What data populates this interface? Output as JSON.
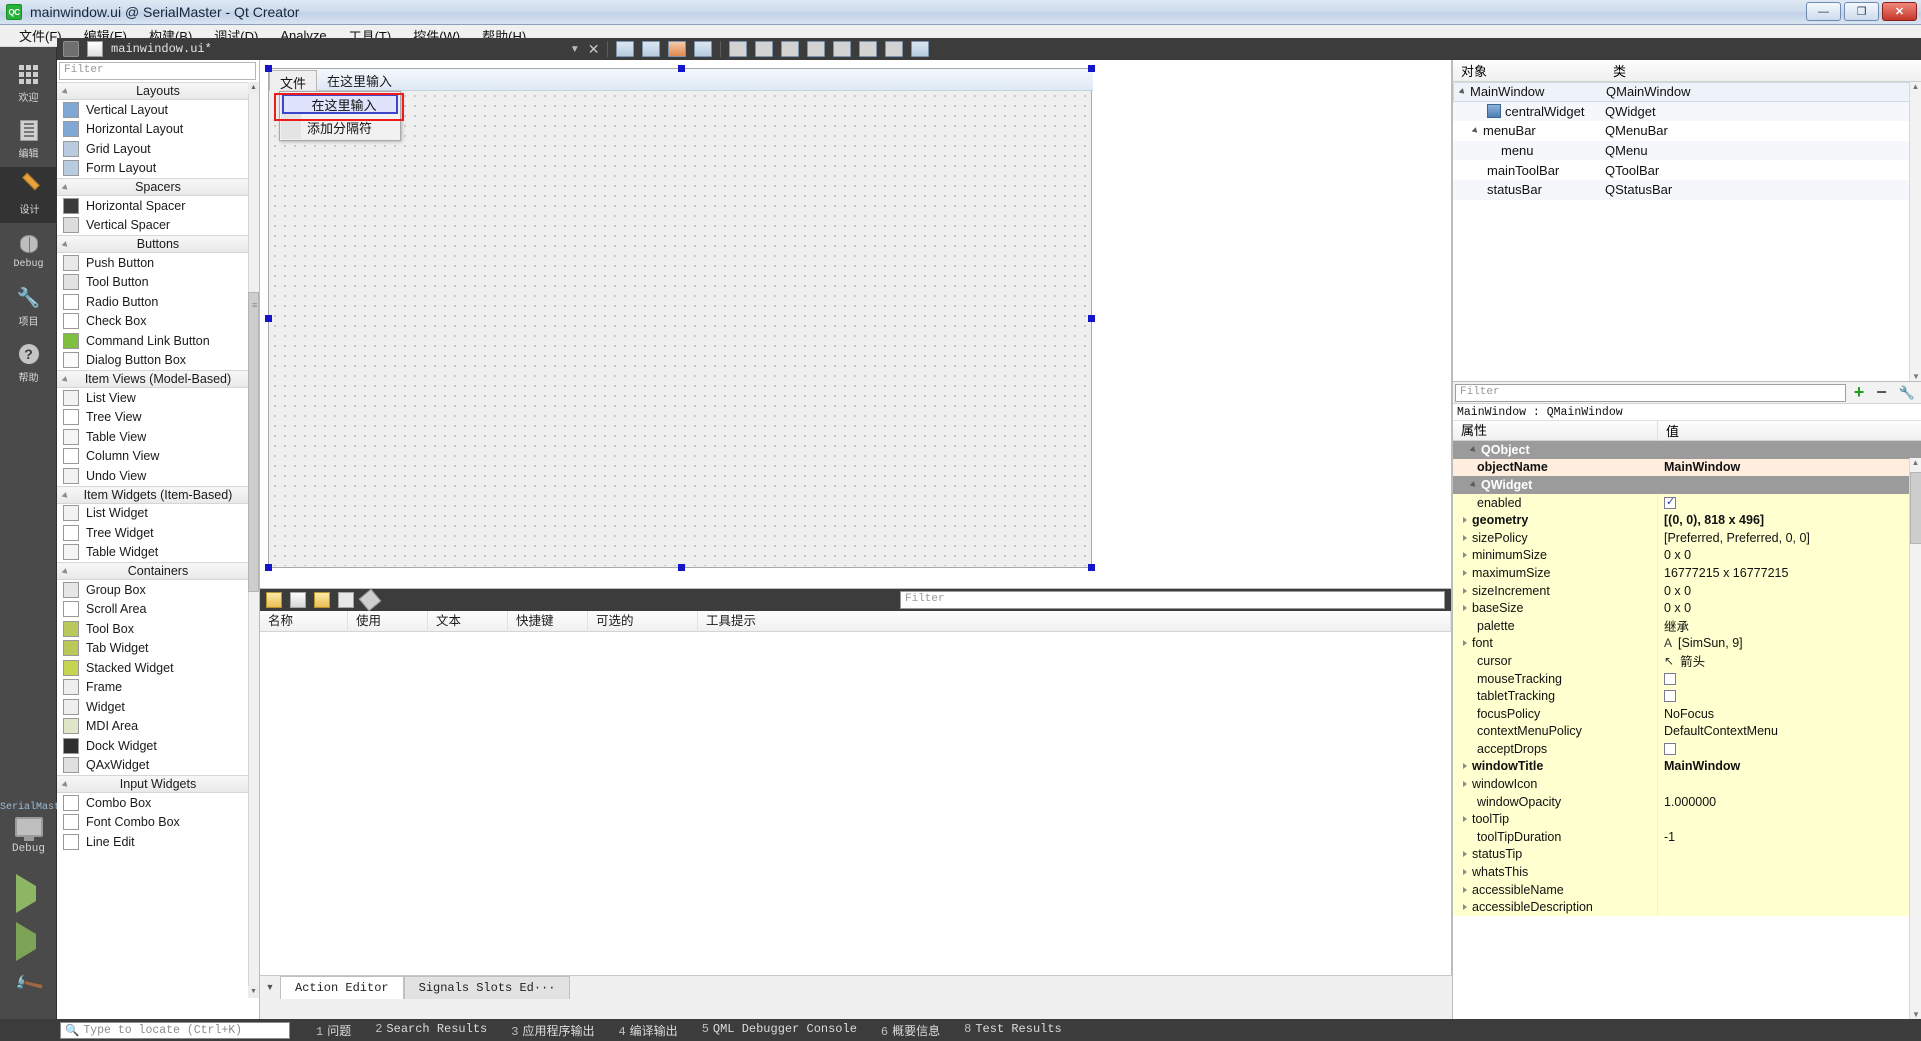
{
  "window": {
    "logo": "QC",
    "title": "mainwindow.ui @ SerialMaster - Qt Creator",
    "minimize": "—",
    "maximize": "❐",
    "close": "✕"
  },
  "menubar": {
    "items": [
      {
        "label": "文件(F)"
      },
      {
        "label": "编辑(E)"
      },
      {
        "label": "构建(B)"
      },
      {
        "label": "调试(D)"
      },
      {
        "label": "Analyze"
      },
      {
        "label": "工具(T)"
      },
      {
        "label": "控件(W)"
      },
      {
        "label": "帮助(H)"
      }
    ]
  },
  "modebar": {
    "items": [
      {
        "label": "欢迎",
        "icon": "grid-icon",
        "active": false
      },
      {
        "label": "编辑",
        "icon": "document-icon",
        "active": false
      },
      {
        "label": "设计",
        "icon": "pencil-icon",
        "active": true
      },
      {
        "label": "Debug",
        "icon": "bug-icon",
        "active": false
      },
      {
        "label": "项目",
        "icon": "wrench-icon",
        "active": false
      },
      {
        "label": "帮助",
        "icon": "question-icon",
        "active": false
      }
    ],
    "kit_name": "SerialMaster",
    "kit_config": "Debug",
    "run_label": "run-button",
    "debug_label": "run-debug-button",
    "build_label": "build-button"
  },
  "editor_tab": {
    "filename": "mainwindow.ui*",
    "lock_icon": "unlocked-icon",
    "file_icon": "ui-file-icon",
    "dropdown_icon": "chevron-down-icon",
    "close_icon": "close-icon",
    "tools": [
      "edit-widgets-icon",
      "edit-signals-slots-icon",
      "edit-buddies-icon",
      "edit-tab-order-icon",
      "layout-horizontally-icon",
      "layout-vertically-icon",
      "layout-splitter-h-icon",
      "layout-splitter-v-icon",
      "layout-form-icon",
      "layout-grid-icon",
      "break-layout-icon",
      "adjust-size-icon"
    ]
  },
  "widget_box": {
    "filter_placeholder": "Filter",
    "groups": [
      {
        "title": "Layouts",
        "items": [
          {
            "label": "Vertical Layout",
            "icon": "vertical-layout-icon"
          },
          {
            "label": "Horizontal Layout",
            "icon": "horizontal-layout-icon"
          },
          {
            "label": "Grid Layout",
            "icon": "grid-layout-icon"
          },
          {
            "label": "Form Layout",
            "icon": "form-layout-icon"
          }
        ]
      },
      {
        "title": "Spacers",
        "items": [
          {
            "label": "Horizontal Spacer",
            "icon": "horizontal-spacer-icon"
          },
          {
            "label": "Vertical Spacer",
            "icon": "vertical-spacer-icon"
          }
        ]
      },
      {
        "title": "Buttons",
        "items": [
          {
            "label": "Push Button",
            "icon": "push-button-icon"
          },
          {
            "label": "Tool Button",
            "icon": "tool-button-icon"
          },
          {
            "label": "Radio Button",
            "icon": "radio-button-icon"
          },
          {
            "label": "Check Box",
            "icon": "check-box-icon"
          },
          {
            "label": "Command Link Button",
            "icon": "command-link-icon"
          },
          {
            "label": "Dialog Button Box",
            "icon": "dialog-button-box-icon"
          }
        ]
      },
      {
        "title": "Item Views (Model-Based)",
        "items": [
          {
            "label": "List View",
            "icon": "list-view-icon"
          },
          {
            "label": "Tree View",
            "icon": "tree-view-icon"
          },
          {
            "label": "Table View",
            "icon": "table-view-icon"
          },
          {
            "label": "Column View",
            "icon": "column-view-icon"
          },
          {
            "label": "Undo View",
            "icon": "undo-view-icon"
          }
        ]
      },
      {
        "title": "Item Widgets (Item-Based)",
        "items": [
          {
            "label": "List Widget",
            "icon": "list-widget-icon"
          },
          {
            "label": "Tree Widget",
            "icon": "tree-widget-icon"
          },
          {
            "label": "Table Widget",
            "icon": "table-widget-icon"
          }
        ]
      },
      {
        "title": "Containers",
        "items": [
          {
            "label": "Group Box",
            "icon": "group-box-icon"
          },
          {
            "label": "Scroll Area",
            "icon": "scroll-area-icon"
          },
          {
            "label": "Tool Box",
            "icon": "tool-box-icon"
          },
          {
            "label": "Tab Widget",
            "icon": "tab-widget-icon"
          },
          {
            "label": "Stacked Widget",
            "icon": "stacked-widget-icon"
          },
          {
            "label": "Frame",
            "icon": "frame-icon"
          },
          {
            "label": "Widget",
            "icon": "widget-icon"
          },
          {
            "label": "MDI Area",
            "icon": "mdi-area-icon"
          },
          {
            "label": "Dock Widget",
            "icon": "dock-widget-icon"
          },
          {
            "label": "QAxWidget",
            "icon": "qaxwidget-icon"
          }
        ]
      },
      {
        "title": "Input Widgets",
        "items": [
          {
            "label": "Combo Box",
            "icon": "combo-box-icon"
          },
          {
            "label": "Font Combo Box",
            "icon": "font-combo-box-icon"
          },
          {
            "label": "Line Edit",
            "icon": "line-edit-icon"
          }
        ]
      }
    ]
  },
  "canvas": {
    "form_menubar": [
      {
        "label": "文件",
        "selected": true
      },
      {
        "label": "在这里输入",
        "selected": false
      }
    ],
    "dropdown": [
      {
        "label": "在这里输入",
        "editing": true
      },
      {
        "label": "添加分隔符",
        "editing": false
      }
    ]
  },
  "action_editor": {
    "toolbar_icons": [
      "new-action-icon",
      "copy-action-icon",
      "paste-action-icon",
      "delete-action-icon",
      "edit-action-icon"
    ],
    "filter_placeholder": "Filter",
    "columns": [
      "名称",
      "使用",
      "文本",
      "快捷键",
      "可选的",
      "工具提示"
    ],
    "rows": [],
    "tabs": [
      {
        "label": "Action Editor",
        "active": true
      },
      {
        "label": "Signals  Slots Ed···",
        "active": false
      }
    ]
  },
  "object_inspector": {
    "columns": [
      "对象",
      "类"
    ],
    "rows": [
      {
        "name": "MainWindow",
        "class": "QMainWindow",
        "indent": 0,
        "expander": "down",
        "icon": "",
        "selected": true
      },
      {
        "name": "centralWidget",
        "class": "QWidget",
        "indent": 2,
        "expander": "",
        "icon": "central-widget-icon",
        "selected": false
      },
      {
        "name": "menuBar",
        "class": "QMenuBar",
        "indent": 1,
        "expander": "down",
        "icon": "",
        "selected": false
      },
      {
        "name": "menu",
        "class": "QMenu",
        "indent": 3,
        "expander": "",
        "icon": "",
        "selected": false
      },
      {
        "name": "mainToolBar",
        "class": "QToolBar",
        "indent": 2,
        "expander": "",
        "icon": "",
        "selected": false
      },
      {
        "name": "statusBar",
        "class": "QStatusBar",
        "indent": 2,
        "expander": "",
        "icon": "",
        "selected": false
      }
    ]
  },
  "property_editor": {
    "filter_placeholder": "Filter",
    "add_icon": "plus-icon",
    "remove_icon": "minus-icon",
    "config_icon": "wrench-icon",
    "object_line": "MainWindow : QMainWindow",
    "columns": [
      "属性",
      "值"
    ],
    "rows": [
      {
        "key": "QObject",
        "value": "",
        "type": "group",
        "expander": "down",
        "bold": true
      },
      {
        "key": "objectName",
        "value": "MainWindow",
        "type": "peach",
        "expander": "",
        "bold": true
      },
      {
        "key": "QWidget",
        "value": "",
        "type": "group",
        "expander": "down",
        "bold": true
      },
      {
        "key": "enabled",
        "value": "",
        "type": "yellow",
        "expander": "",
        "checkbox": true,
        "checked": true
      },
      {
        "key": "geometry",
        "value": "[(0, 0), 818 x 496]",
        "type": "yellow",
        "expander": "right",
        "bold": true
      },
      {
        "key": "sizePolicy",
        "value": "[Preferred, Preferred, 0, 0]",
        "type": "yellow",
        "expander": "right"
      },
      {
        "key": "minimumSize",
        "value": "0 x 0",
        "type": "yellow",
        "expander": "right"
      },
      {
        "key": "maximumSize",
        "value": "16777215 x 16777215",
        "type": "yellow",
        "expander": "right"
      },
      {
        "key": "sizeIncrement",
        "value": "0 x 0",
        "type": "yellow",
        "expander": "right"
      },
      {
        "key": "baseSize",
        "value": "0 x 0",
        "type": "yellow",
        "expander": "right"
      },
      {
        "key": "palette",
        "value": "继承",
        "type": "yellow",
        "expander": ""
      },
      {
        "key": "font",
        "value": "[SimSun, 9]",
        "type": "yellow",
        "expander": "right",
        "prefix": "A"
      },
      {
        "key": "cursor",
        "value": "箭头",
        "type": "yellow",
        "expander": "",
        "prefix": "↖"
      },
      {
        "key": "mouseTracking",
        "value": "",
        "type": "yellow",
        "expander": "",
        "checkbox": true,
        "checked": false
      },
      {
        "key": "tabletTracking",
        "value": "",
        "type": "yellow",
        "expander": "",
        "checkbox": true,
        "checked": false
      },
      {
        "key": "focusPolicy",
        "value": "NoFocus",
        "type": "yellow",
        "expander": ""
      },
      {
        "key": "contextMenuPolicy",
        "value": "DefaultContextMenu",
        "type": "yellow",
        "expander": ""
      },
      {
        "key": "acceptDrops",
        "value": "",
        "type": "yellow",
        "expander": "",
        "checkbox": true,
        "checked": false
      },
      {
        "key": "windowTitle",
        "value": "MainWindow",
        "type": "yellow",
        "expander": "right",
        "bold": true
      },
      {
        "key": "windowIcon",
        "value": "",
        "type": "yellow",
        "expander": "right"
      },
      {
        "key": "windowOpacity",
        "value": "1.000000",
        "type": "yellow",
        "expander": ""
      },
      {
        "key": "toolTip",
        "value": "",
        "type": "yellow",
        "expander": "right"
      },
      {
        "key": "toolTipDuration",
        "value": "-1",
        "type": "yellow",
        "expander": ""
      },
      {
        "key": "statusTip",
        "value": "",
        "type": "yellow",
        "expander": "right"
      },
      {
        "key": "whatsThis",
        "value": "",
        "type": "yellow",
        "expander": "right"
      },
      {
        "key": "accessibleName",
        "value": "",
        "type": "yellow",
        "expander": "right"
      },
      {
        "key": "accessibleDescription",
        "value": "",
        "type": "yellow",
        "expander": "right"
      }
    ]
  },
  "statusbar": {
    "locator_placeholder": "Type to locate (Ctrl+K)",
    "search_icon": "search-icon",
    "outputs": [
      {
        "num": "1",
        "label": "问题"
      },
      {
        "num": "2",
        "label": "Search Results"
      },
      {
        "num": "3",
        "label": "应用程序输出"
      },
      {
        "num": "4",
        "label": "编译输出"
      },
      {
        "num": "5",
        "label": "QML Debugger Console"
      },
      {
        "num": "6",
        "label": "概要信息"
      },
      {
        "num": "8",
        "label": "Test Results"
      }
    ]
  },
  "colors": {
    "accent": "#3c46c8",
    "highlight_red": "#ef1a1a",
    "handle_blue": "#1414c8",
    "property_yellow": "#ffffcf",
    "property_peach": "#ffeedd",
    "group_gray": "#9b9b9b"
  }
}
